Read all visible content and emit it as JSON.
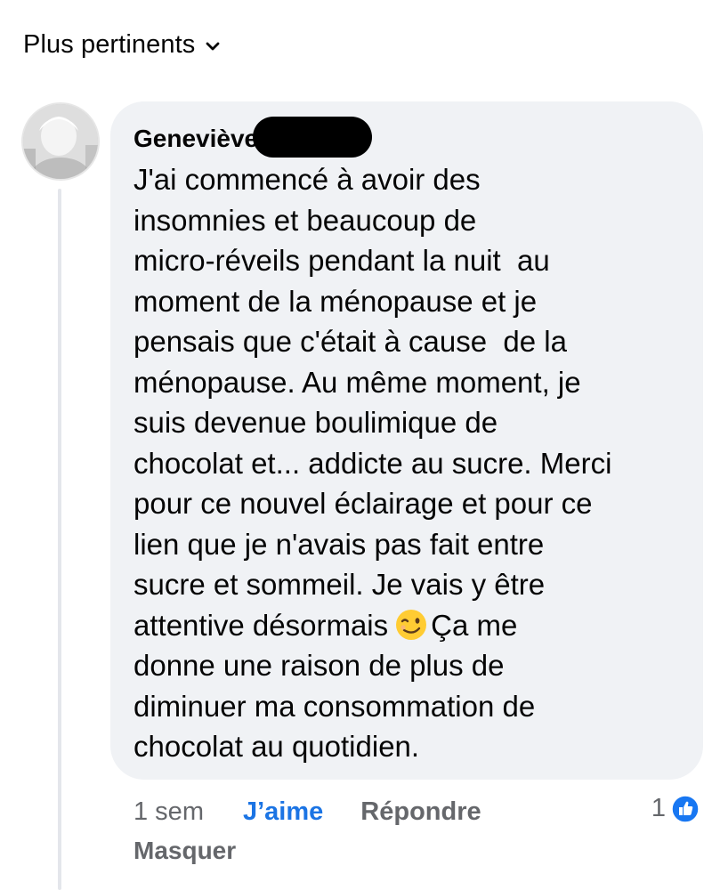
{
  "sort": {
    "label": "Plus pertinents",
    "icon": "chevron-down-icon"
  },
  "comment": {
    "author": "Geneviève",
    "author_surname_redacted": true,
    "avatar_icon": "avatar-photo",
    "lines": [
      "J'ai commencé à avoir des",
      "insomnies et beaucoup de",
      "micro-réveils pendant la nuit  au",
      "moment de la ménopause et je",
      "pensais que c'était à cause  de la",
      "ménopause. Au même moment, je",
      "suis devenue boulimique de",
      "chocolat et... addicte au sucre. Merci",
      "pour ce nouvel éclairage et pour ce",
      "lien que je n'avais pas fait entre",
      "sucre et sommeil. Je vais y être"
    ],
    "line_with_emoji_before": "attentive désormais",
    "emoji": "winking-face-emoji",
    "line_with_emoji_after": "Ça me",
    "lines_after": [
      "donne une raison de plus de",
      "diminuer ma consommation de",
      "chocolat au quotidien."
    ]
  },
  "actions": {
    "time": "1 sem",
    "like": "J’aime",
    "reply": "Répondre",
    "hide": "Masquer",
    "reaction_count": "1",
    "reaction_icon": "like-badge-icon"
  },
  "colors": {
    "bubble": "#f0f2f5",
    "like_active": "#1b74e4",
    "secondary_text": "#65676b",
    "primary_text": "#050505"
  }
}
